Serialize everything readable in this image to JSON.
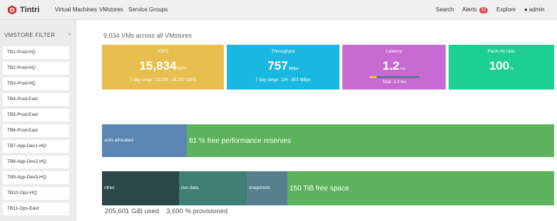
{
  "nav": {
    "brand": "Tintri",
    "links": [
      "Virtual Machines",
      "VMstores",
      "Service Groups"
    ],
    "search": "Search",
    "alerts_label": "Alerts",
    "alerts_count": "12",
    "explore": "Explore",
    "user": "admin"
  },
  "sidebar": {
    "title": "VMSTORE FILTER",
    "close": "×",
    "items": [
      "TB1-Prod-HQ",
      "TB2-Prod-HQ",
      "TB3-Prod-HQ",
      "TB4-Prod-East",
      "TB5-Prod-East",
      "TB6-Prod-East",
      "TB7-App-Dev1-HQ",
      "TB8-App-Dev2-HQ",
      "TB9-App-Dev3-HQ",
      "TB10-Ops-HQ",
      "TB11-Ops-East"
    ]
  },
  "summary": "9,034 VMs across all VMstores",
  "tiles": {
    "iops": {
      "title": "IOPS",
      "value": "15,834",
      "unit": "IOPS",
      "sub": "7 day range: 13,078 - 18,202 IOPS",
      "color": "#e8bf4f"
    },
    "throughput": {
      "title": "Throughput",
      "value": "757",
      "unit": "MBps",
      "sub": "7 day range: 134 - 803 MBps",
      "color": "#1ab7e0"
    },
    "latency": {
      "title": "Latency",
      "value": "1.2",
      "unit": "ms",
      "sub": "Total: 1.3 ms",
      "color": "#c76ad2"
    },
    "flash": {
      "title": "Flash hit ratio",
      "value": "100",
      "unit": "%",
      "color": "#1dcf93"
    }
  },
  "performance": {
    "allocated_label": "auto-allocated",
    "free_label": "81 % free performance reserves",
    "allocated_color": "#5a86b3",
    "free_color": "#5cb35c"
  },
  "space": {
    "other_label": "other",
    "live_label": "live data",
    "snapshots_label": "snapshots",
    "free_label": "150 TiB free space",
    "colors": {
      "other": "#2a4848",
      "live": "#3f7f76",
      "snapshots": "#56808e",
      "free": "#5cb35c"
    }
  },
  "footer": {
    "used": "205,601 GiB used",
    "provisioned": "3,690 % provisioned"
  }
}
